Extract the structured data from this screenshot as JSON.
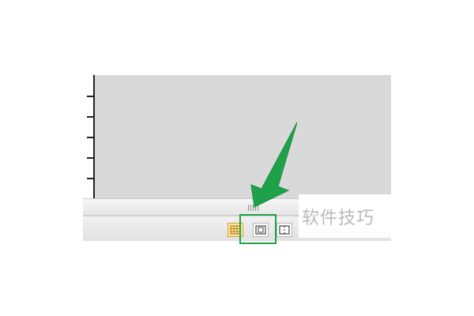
{
  "watermark": {
    "text": "软件技巧"
  },
  "status_bar": {
    "view_buttons": [
      {
        "name": "normal-view",
        "icon": "grid-icon",
        "selected": true
      },
      {
        "name": "page-layout-view",
        "icon": "page-layout-icon",
        "selected": false
      },
      {
        "name": "page-break-preview-view",
        "icon": "page-break-icon",
        "selected": false
      }
    ]
  },
  "colors": {
    "workspace": "#d9d9d9",
    "highlight": "#1fa14a",
    "arrow": "#1fa14a",
    "selected_button": "#ffe8a6"
  }
}
